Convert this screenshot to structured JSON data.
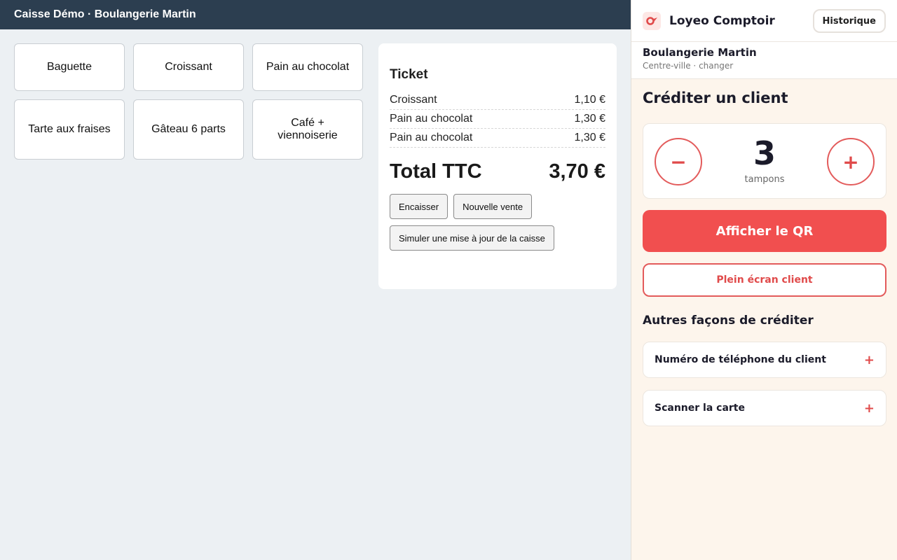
{
  "pos": {
    "header_title": "Caisse Démo · Boulangerie Martin",
    "products": [
      "Baguette",
      "Croissant",
      "Pain au chocolat",
      "Tarte aux fraises",
      "Gâteau 6 parts",
      "Café + viennoiserie"
    ],
    "ticket": {
      "title": "Ticket",
      "lines": [
        {
          "name": "Croissant",
          "price": "1,10 €"
        },
        {
          "name": "Pain au chocolat",
          "price": "1,30 €"
        },
        {
          "name": "Pain au chocolat",
          "price": "1,30 €"
        }
      ],
      "total_label": "Total TTC",
      "total_value": "3,70 €",
      "buttons": {
        "checkout": "Encaisser",
        "new_sale": "Nouvelle vente",
        "simulate": "Simuler une mise à jour de la caisse"
      }
    }
  },
  "panel": {
    "brand": "Loyeo Comptoir",
    "history_button": "Historique",
    "shop_name": "Boulangerie Martin",
    "shop_sub": "Centre-ville · changer",
    "credit_title": "Créditer un client",
    "stamp_count": "3",
    "stamp_unit": "tampons",
    "minus_label": "−",
    "plus_label": "+",
    "qr_button": "Afficher le QR",
    "fullscreen_button": "Plein écran client",
    "other_title": "Autres façons de créditer",
    "options": [
      {
        "label": "Numéro de téléphone du client",
        "icon": "plus-icon"
      },
      {
        "label": "Scanner la carte",
        "icon": "plus-icon"
      }
    ]
  },
  "colors": {
    "pos_header": "#2c3e50",
    "accent_red": "#f14f4f",
    "panel_bg": "#fdf5ec"
  }
}
